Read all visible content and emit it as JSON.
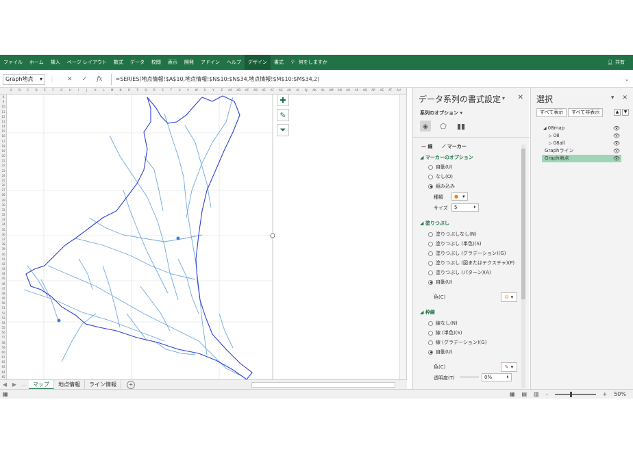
{
  "ribbon": {
    "tabs": [
      "ファイル",
      "ホーム",
      "挿入",
      "ページ レイアウト",
      "数式",
      "データ",
      "校閲",
      "表示",
      "開発",
      "アドイン",
      "ヘルプ",
      "デザイン",
      "書式"
    ],
    "active_tab": "デザイン",
    "tell_me": "何をしますか",
    "share": "共有"
  },
  "formula_bar": {
    "namebox": "Graph地点",
    "fx": "fx",
    "formula": "=SERIES(地点情報!$A$10,地点情報!$N$10:$N$34,地点情報!$M$10:$M$34,2)"
  },
  "sheet": {
    "column_headers": [
      "A",
      "B",
      "C",
      "D",
      "E",
      "F",
      "G",
      "H",
      "I",
      "J",
      "K",
      "L",
      "M",
      "N",
      "O",
      "P",
      "Q",
      "R",
      "S",
      "T",
      "U",
      "V",
      "W",
      "X",
      "Y",
      "Z",
      "AA",
      "AB",
      "AC",
      "AD",
      "AE",
      "AF",
      "AG",
      "AH",
      "AI",
      "AJ",
      "AK",
      "AL",
      "AM",
      "AN",
      "AO",
      "AP",
      "AQ",
      "AR",
      "AS",
      "AT",
      "AU"
    ],
    "row_headers": [
      "8",
      "9",
      "10",
      "11",
      "12",
      "13",
      "14",
      "15",
      "16",
      "17",
      "18",
      "19",
      "20",
      "21",
      "22",
      "23",
      "24",
      "25",
      "26",
      "27",
      "28",
      "29",
      "30",
      "31",
      "32",
      "33",
      "34",
      "35",
      "36",
      "37",
      "38",
      "39",
      "40",
      "41",
      "42",
      "43",
      "44",
      "45",
      "46",
      "47",
      "48",
      "49",
      "50",
      "51",
      "52",
      "53",
      "54",
      "55",
      "56",
      "57",
      "58",
      "59",
      "60",
      "61",
      "62",
      "63",
      "64",
      "65"
    ],
    "tabs": [
      "マップ",
      "地点情報",
      "ライン情報"
    ],
    "active_tab": "マップ",
    "add_sheet": "+"
  },
  "chart_tools": {
    "elements_icon": "plus-icon",
    "styles_icon": "brush-icon",
    "filter_icon": "funnel-icon"
  },
  "format_pane": {
    "title": "データ系列の書式設定",
    "series_options_label": "系列のオプション",
    "subtabs": [
      "線",
      "マーカー"
    ],
    "marker_options": {
      "header": "マーカーのオプション",
      "options": [
        "自動(U)",
        "なし(O)",
        "組み込み"
      ],
      "selected": "組み込み",
      "type_label": "種類",
      "size_label": "サイズ",
      "size_value": "5"
    },
    "fill": {
      "header": "塗りつぶし",
      "options": [
        "塗りつぶしなし(N)",
        "塗りつぶし (単色)(S)",
        "塗りつぶし (グラデーション)(G)",
        "塗りつぶし (図またはテクスチャ)(P)",
        "塗りつぶし (パターン)(A)",
        "自動(U)"
      ],
      "selected": "自動(U)",
      "color_label": "色(C)"
    },
    "border": {
      "header": "枠線",
      "options": [
        "線なし(N)",
        "線 (単色)(S)",
        "線 (グラデーション)(G)",
        "自動(U)"
      ],
      "selected": "自動(U)",
      "color_label": "色(C)",
      "transparency_label": "透明度(T)",
      "transparency_value": "0%"
    }
  },
  "selection_pane": {
    "title": "選択",
    "show_all": "すべて表示",
    "hide_all": "すべて非表示",
    "items": [
      {
        "label": "08map",
        "prefix": "◢",
        "selected": false
      },
      {
        "label": "08",
        "prefix": "▷",
        "selected": false
      },
      {
        "label": "08all",
        "prefix": "▷",
        "selected": false
      },
      {
        "label": "Graphライン",
        "prefix": "",
        "selected": false
      },
      {
        "label": "Graph地点",
        "prefix": "",
        "selected": true
      }
    ]
  },
  "status_bar": {
    "zoom": "50%",
    "zoom_minus": "-",
    "zoom_plus": "+"
  },
  "colors": {
    "excel_green": "#217346",
    "map_border": "#2b3fd6",
    "map_rivers": "#6fa8dc",
    "marker": "#3a7fd5",
    "selected_item": "#9fd5b7"
  }
}
